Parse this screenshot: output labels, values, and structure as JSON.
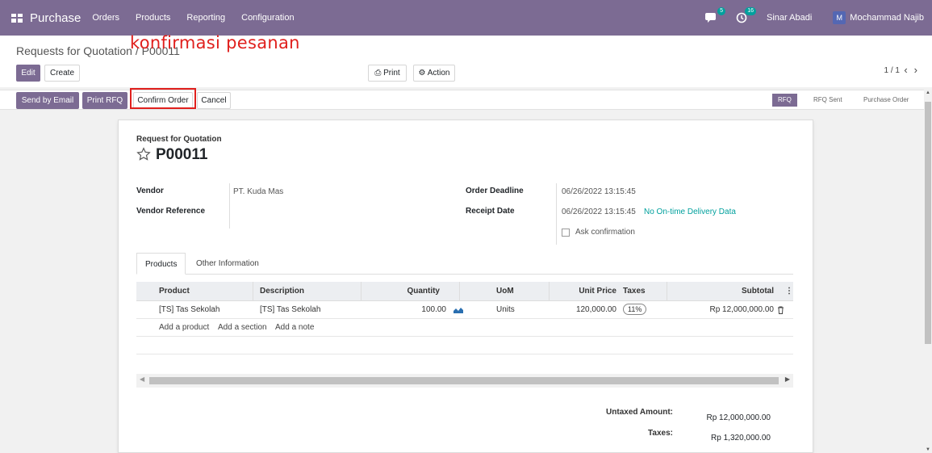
{
  "nav": {
    "app_name": "Purchase",
    "menu": [
      "Orders",
      "Products",
      "Reporting",
      "Configuration"
    ],
    "chat_count": "5",
    "activity_count": "16",
    "company": "Sinar Abadi",
    "user_initial": "M",
    "user_name": "Mochammad Najib"
  },
  "breadcrumb": {
    "parent": "Requests for Quotation",
    "separator": " / ",
    "current": "P00011"
  },
  "toolbar": {
    "edit": "Edit",
    "create": "Create",
    "print": "Print",
    "action": "Action",
    "pager": "1 / 1"
  },
  "annotation": "konfirmasi pesanan",
  "statusbar": {
    "send_email": "Send by Email",
    "print_rfq": "Print RFQ",
    "confirm": "Confirm Order",
    "cancel": "Cancel",
    "stages": [
      "RFQ",
      "RFQ Sent",
      "Purchase Order"
    ]
  },
  "form": {
    "doc_type": "Request for Quotation",
    "number": "P00011",
    "vendor_label": "Vendor",
    "vendor_value": "PT. Kuda Mas",
    "vendor_ref_label": "Vendor Reference",
    "deadline_label": "Order Deadline",
    "deadline_value": "06/26/2022 13:15:45",
    "receipt_label": "Receipt Date",
    "receipt_value": "06/26/2022 13:15:45",
    "receipt_note": "No On-time Delivery Data",
    "ask_confirmation": "Ask confirmation"
  },
  "tabs": [
    "Products",
    "Other Information"
  ],
  "table": {
    "headers": [
      "Product",
      "Description",
      "Quantity",
      "UoM",
      "Unit Price",
      "Taxes",
      "Subtotal"
    ],
    "rows": [
      {
        "product": "[TS] Tas Sekolah",
        "description": "[TS] Tas Sekolah",
        "quantity": "100.00",
        "uom": "Units",
        "unit_price": "120,000.00",
        "taxes": "11%",
        "subtotal": "Rp 12,000,000.00"
      }
    ],
    "add_product": "Add a product",
    "add_section": "Add a section",
    "add_note": "Add a note"
  },
  "totals": {
    "untaxed_label": "Untaxed Amount:",
    "untaxed_value": "Rp 12,000,000.00",
    "taxes_label": "Taxes:",
    "taxes_value": "Rp 1,320,000.00"
  },
  "colors": {
    "brand": "#7c6b93",
    "link": "#00a09d",
    "annotation": "#e0201d"
  }
}
